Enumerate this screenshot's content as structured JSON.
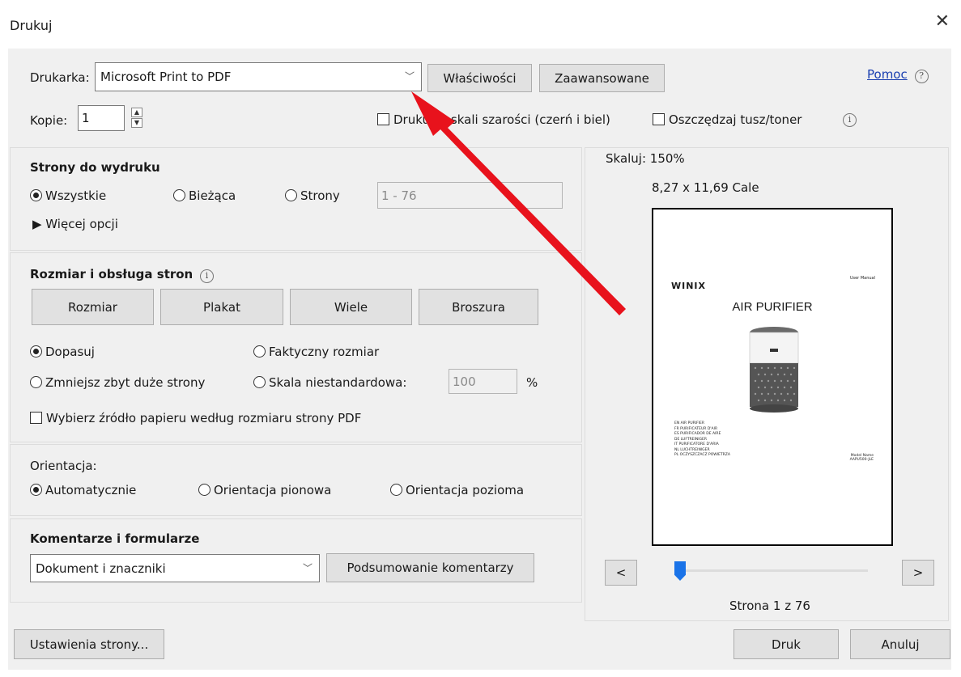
{
  "window": {
    "title": "Drukuj",
    "close_glyph": "✕"
  },
  "printer": {
    "label": "Drukarka:",
    "value": "Microsoft Print to PDF",
    "properties_btn": "Właściwości",
    "advanced_btn": "Zaawansowane",
    "help_link": "Pomoc",
    "help_icon": "?"
  },
  "copies": {
    "label": "Kopie:",
    "value": "1",
    "up": "▲",
    "down": "▼"
  },
  "grayscale": {
    "label": "Drukuj w skali szarości (czerń i biel)",
    "checked": false
  },
  "save_ink": {
    "label": "Oszczędzaj tusz/toner",
    "checked": false
  },
  "info_glyph": "i",
  "pages": {
    "title": "Strony do wydruku",
    "all": "Wszystkie",
    "current": "Bieżąca",
    "pages": "Strony",
    "range_value": "1 - 76",
    "more_options": "▶ Więcej opcji"
  },
  "sizing": {
    "title": "Rozmiar i obsługa stron",
    "buttons": [
      "Rozmiar",
      "Plakat",
      "Wiele",
      "Broszura"
    ],
    "fit": "Dopasuj",
    "actual": "Faktyczny rozmiar",
    "shrink": "Zmniejsz zbyt duże strony",
    "custom": "Skala niestandardowa:",
    "custom_value": "100",
    "percent": "%",
    "paper_source": "Wybierz źródło papieru według rozmiaru strony PDF"
  },
  "orientation": {
    "title": "Orientacja:",
    "auto": "Automatycznie",
    "portrait": "Orientacja pionowa",
    "landscape": "Orientacja pozioma"
  },
  "comments": {
    "title": "Komentarze i formularze",
    "value": "Dokument i znaczniki",
    "summary_btn": "Podsumowanie komentarzy"
  },
  "preview": {
    "scale": "Skaluj: 150%",
    "size": "8,27 x 11,69 Cale",
    "doc_logo": "WINIX",
    "doc_um": "User Manual",
    "doc_title": "AIR PURIFIER",
    "doc_langs": [
      "EN  AIR PURIFIER",
      "FR  PURIFICATEUR D'AIR",
      "ES  PURIFICADOR DE AIRE",
      "DE  LUFTREINIGER",
      "IT  PURIFICATORE D'ARIA",
      "NL  LUCHTREINIGER",
      "PL  OCZYSZCZACZ POWIETRZA"
    ],
    "doc_model": "Model Name",
    "doc_model_id": "AAPU500-JLE",
    "prev": "<",
    "next": ">",
    "page_label": "Strona 1 z 76",
    "slider_position": 0.0
  },
  "footer": {
    "page_setup": "Ustawienia strony...",
    "print": "Druk",
    "cancel": "Anuluj"
  },
  "colors": {
    "accent": "#1a73e8",
    "arrow": "#e8121c",
    "link": "#1a3fb0"
  }
}
